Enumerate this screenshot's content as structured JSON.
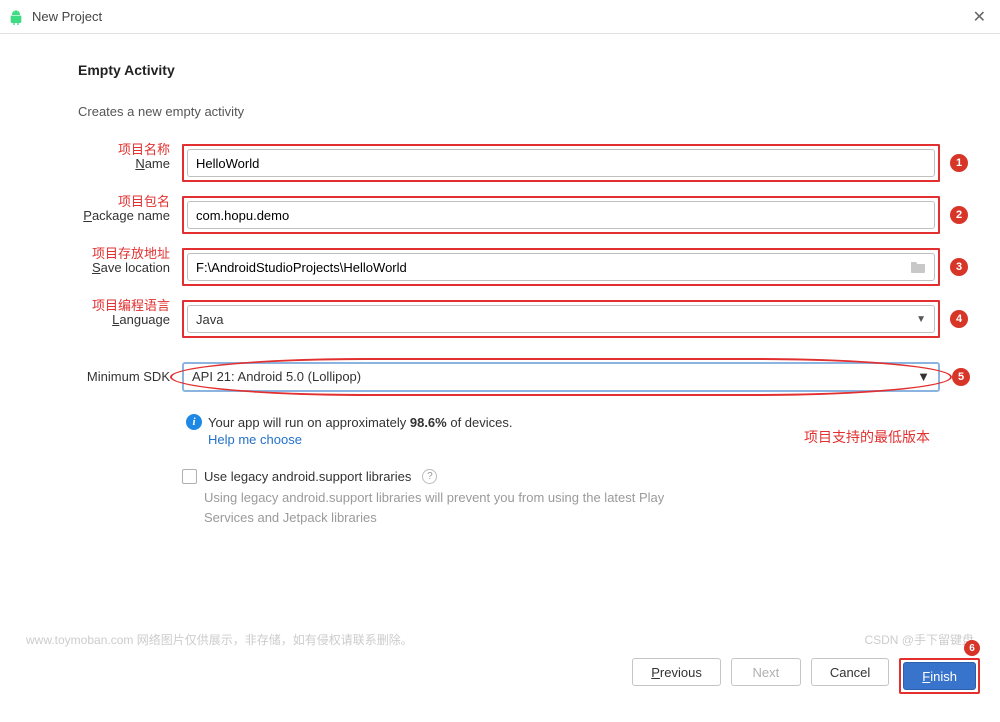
{
  "window": {
    "title": "New Project"
  },
  "heading": "Empty Activity",
  "description": "Creates a new empty activity",
  "annotations": {
    "name": "项目名称",
    "package": "项目包名",
    "save": "项目存放地址",
    "language": "项目编程语言",
    "sdk": "项目支持的最低版本"
  },
  "labels": {
    "name_pre": "",
    "name_u": "N",
    "name_post": "ame",
    "package_pre": "",
    "package_u": "P",
    "package_post": "ackage name",
    "save_pre": "",
    "save_u": "S",
    "save_post": "ave location",
    "language_pre": "",
    "language_u": "L",
    "language_post": "anguage",
    "sdk": "Minimum SDK"
  },
  "fields": {
    "name": "HelloWorld",
    "package": "com.hopu.demo",
    "save": "F:\\AndroidStudioProjects\\HelloWorld",
    "language": "Java",
    "sdk": "API 21: Android 5.0 (Lollipop)"
  },
  "badges": {
    "b1": "1",
    "b2": "2",
    "b3": "3",
    "b4": "4",
    "b5": "5",
    "b6": "6"
  },
  "info": {
    "text_pre": "Your app will run on approximately ",
    "pct": "98.6%",
    "text_post": " of devices.",
    "help": "Help me choose"
  },
  "legacy": {
    "label": "Use legacy android.support libraries",
    "desc": "Using legacy android.support libraries will prevent you from using the latest Play Services and Jetpack libraries"
  },
  "buttons": {
    "previous_u": "P",
    "previous_post": "revious",
    "next": "Next",
    "cancel": "Cancel",
    "finish_u": "F",
    "finish_post": "inish"
  },
  "watermark": {
    "left": "www.toymoban.com   网络图片仅供展示，非存储，如有侵权请联系删除。",
    "right": "CSDN @手下留键盘"
  }
}
